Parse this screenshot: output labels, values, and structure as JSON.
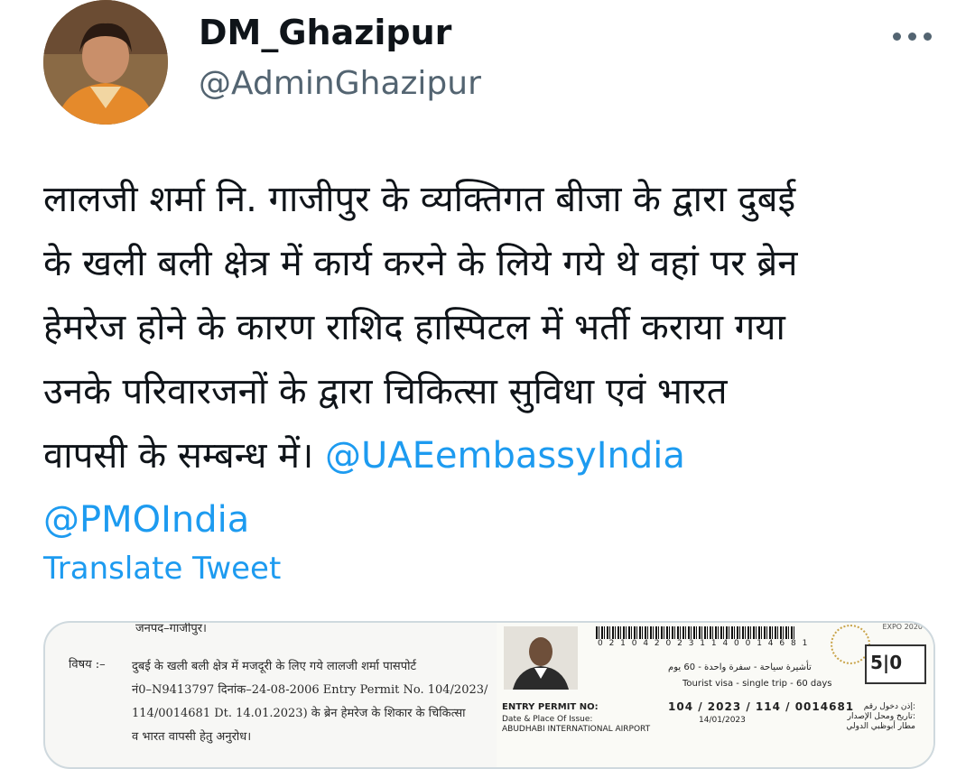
{
  "tweet": {
    "author": {
      "display_name": "DM_Ghazipur",
      "handle": "@AdminGhazipur"
    },
    "text_lines": [
      "लालजी शर्मा नि. गाजीपुर के व्यक्तिगत बीजा के द्वारा दुबई",
      "के खली बली क्षेत्र में कार्य करने के लिये गये थे वहां पर ब्रेन",
      "हेमरेज होने के कारण राशिद हास्पिटल में भर्ती कराया गया",
      "उनके परिवारजनों के द्वारा चिकित्सा सुविधा एवं भारत"
    ],
    "text_line5_prefix": "वापसी के सम्बन्ध में। ",
    "mentions": [
      "@UAEembassyIndia",
      "@PMOIndia"
    ],
    "translate_label": "Translate Tweet"
  },
  "media": {
    "letter": {
      "header_fragment": "जनपद–गाजीपुर।",
      "subject_label": "विषय :–",
      "lines": [
        "दुबई के खली बली क्षेत्र में मजदूरी के लिए गये लालजी शर्मा पासपोर्ट",
        "नं0–N9413797 दिनांक–24-08-2006 Entry Permit No. 104/2023/",
        "114/0014681 Dt. 14.01.2023) के ब्रेन हेमरेज के शिकार के चिकित्सा",
        "व भारत वापसी हेतु अनुरोध।"
      ]
    },
    "permit": {
      "barcode_number": "0 2 1 0 4 2 0 2 3 1 1 4 0 0 1 4 6 8 1",
      "visa_arabic": "تأشيرة سياحة - سفرة واحدة - 60 يوم",
      "visa_type": "Tourist visa - single trip - 60 days",
      "entry_permit_label": "ENTRY PERMIT NO:",
      "entry_permit_value": "104 / 2023 / 114 / 0014681",
      "issue_label": "Date & Place Of Issue:",
      "issue_date": "14/01/2023",
      "issue_place": "ABUDHABI INTERNATIONAL AIRPORT",
      "arabic_right": [
        "إذن دخول رقم:",
        "تاريخ ومحل الإصدار:",
        "مطار أبوظبي الدولي"
      ],
      "expo_text": "EXPO 2020",
      "stamp_text": "5|0"
    }
  }
}
